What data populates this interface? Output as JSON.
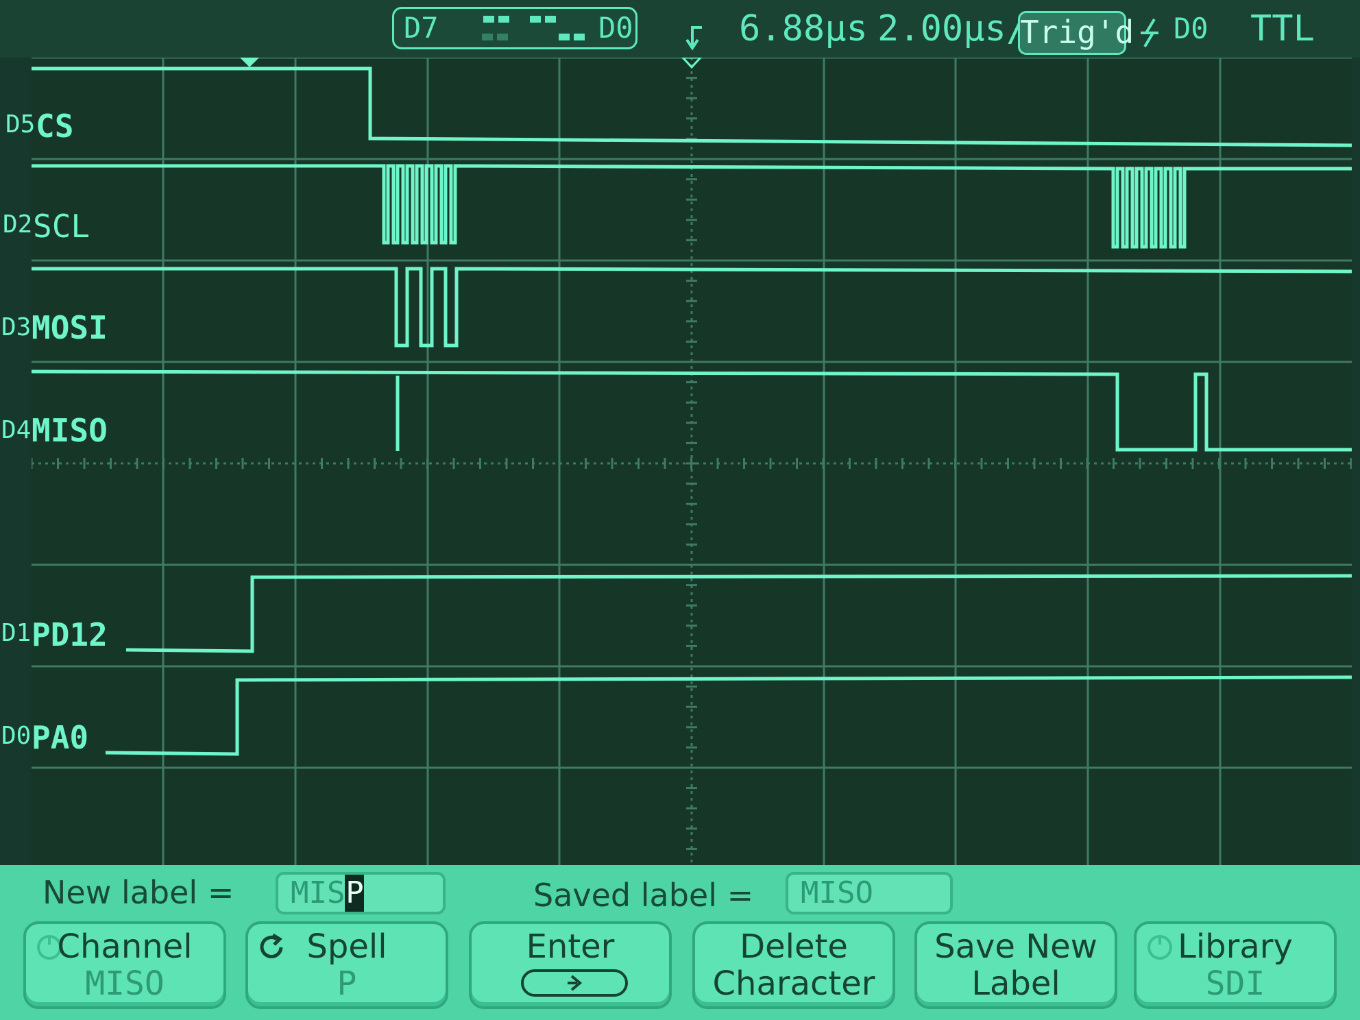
{
  "status": {
    "bit_high": "D7",
    "bit_low": "D0",
    "delay": "6.88µs",
    "timebase": "2.00µs/",
    "trigger_state": "Trig'd",
    "trigger_source": "D0",
    "logic_threshold": "TTL"
  },
  "channels": [
    {
      "index": "D5",
      "label": "CS"
    },
    {
      "index": "D2",
      "label": "SCL"
    },
    {
      "index": "D3",
      "label": "MOSI"
    },
    {
      "index": "D4",
      "label": "MISO"
    },
    {
      "index": "D1",
      "label": "PD12"
    },
    {
      "index": "D0",
      "label": "PA0"
    }
  ],
  "label_editor": {
    "new_label_caption": "New  label  =",
    "new_label_value": "MIS",
    "new_label_cursor_char": "P",
    "saved_label_caption": "Saved  label  =",
    "saved_label_value": "MISO"
  },
  "softkeys": [
    {
      "top": "Channel",
      "bottom": "MISO"
    },
    {
      "top": "Spell",
      "bottom": "P"
    },
    {
      "top": "Enter",
      "bottom": ""
    },
    {
      "top": "Delete",
      "bottom": "Character"
    },
    {
      "top": "Save  New",
      "bottom": "Label"
    },
    {
      "top": "Library",
      "bottom": "SDI"
    }
  ],
  "colors": {
    "trace": "#6ff5c9",
    "graticule": "#3f7a64",
    "screen": "#163628",
    "softkey": "#5ee3b4"
  }
}
